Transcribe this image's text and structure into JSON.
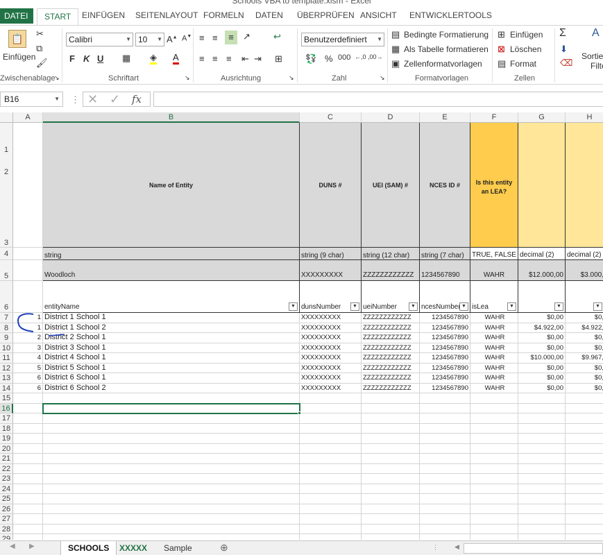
{
  "window": {
    "title": "Schools VBA to template.xlsm - Excel"
  },
  "ribbon_tabs": [
    "DATEI",
    "START",
    "EINFÜGEN",
    "SEITENLAYOUT",
    "FORMELN",
    "DATEN",
    "ÜBERPRÜFEN",
    "ANSICHT",
    "ENTWICKLERTOOLS"
  ],
  "ribbon": {
    "paste_label": "Einfügen",
    "clipboard_label": "Zwischenablage",
    "font_name": "Calibri",
    "font_size": "10",
    "bold": "F",
    "italic": "K",
    "underline": "U",
    "font_label": "Schriftart",
    "align_label": "Ausrichtung",
    "number_format": "Benutzerdefiniert",
    "number_label": "Zahl",
    "cond_format": "Bedingte Formatierung",
    "as_table": "Als Tabelle formatieren",
    "cell_styles": "Zellenformatvorlagen",
    "styles_label": "Formatvorlagen",
    "insert": "Einfügen",
    "delete": "Löschen",
    "format": "Format",
    "cells_label": "Zellen",
    "sort_label": "Sortier",
    "filter_label": "Filte"
  },
  "formula_bar": {
    "name_box": "B16",
    "formula": ""
  },
  "columns": [
    "A",
    "B",
    "C",
    "D",
    "E",
    "F",
    "G",
    "H"
  ],
  "header_row3": {
    "B": "Name of Entity",
    "C": "DUNS #",
    "D": "UEI (SAM) #",
    "E": "NCES ID #",
    "F": "Is this entity an LEA?"
  },
  "row4": {
    "B": "string",
    "C": "string (9 char)",
    "D": "string (12 char)",
    "E": "string (7 char)",
    "F": "TRUE, FALSE",
    "G": "decimal (2)",
    "H": "decimal (2)"
  },
  "row5": {
    "B": "Woodloch",
    "C": "XXXXXXXXX",
    "D": "ZZZZZZZZZZZZ",
    "E": "1234567890",
    "F": "WAHR",
    "G": "$12.000,00",
    "H": "$3.000,"
  },
  "row6": {
    "B": "entityName",
    "C": "dunsNumber",
    "D": "ueiNumber",
    "E": "ncesNumber",
    "F": "isLea"
  },
  "data_rows": [
    {
      "row": "7",
      "A": "1",
      "B": "District 1 School 1",
      "C": "XXXXXXXXX",
      "D": "ZZZZZZZZZZZZ",
      "E": "1234567890",
      "F": "WAHR",
      "G": "$0,00",
      "H": "$0,"
    },
    {
      "row": "8",
      "A": "1",
      "B": "District 1 School 2",
      "C": "XXXXXXXXX",
      "D": "ZZZZZZZZZZZZ",
      "E": "1234567890",
      "F": "WAHR",
      "G": "$4.922,00",
      "H": "$4.922,"
    },
    {
      "row": "9",
      "A": "2",
      "B": "District 2 School 1",
      "C": "XXXXXXXXX",
      "D": "ZZZZZZZZZZZZ",
      "E": "1234567890",
      "F": "WAHR",
      "G": "$0,00",
      "H": "$0,"
    },
    {
      "row": "10",
      "A": "3",
      "B": "District 3 School 1",
      "C": "XXXXXXXXX",
      "D": "ZZZZZZZZZZZZ",
      "E": "1234567890",
      "F": "WAHR",
      "G": "$0,00",
      "H": "$0,"
    },
    {
      "row": "11",
      "A": "4",
      "B": "District 4 School 1",
      "C": "XXXXXXXXX",
      "D": "ZZZZZZZZZZZZ",
      "E": "1234567890",
      "F": "WAHR",
      "G": "$10.000,00",
      "H": "$9.967,"
    },
    {
      "row": "12",
      "A": "5",
      "B": "District 5 School 1",
      "C": "XXXXXXXXX",
      "D": "ZZZZZZZZZZZZ",
      "E": "1234567890",
      "F": "WAHR",
      "G": "$0,00",
      "H": "$0,"
    },
    {
      "row": "13",
      "A": "6",
      "B": "District 6 School 1",
      "C": "XXXXXXXXX",
      "D": "ZZZZZZZZZZZZ",
      "E": "1234567890",
      "F": "WAHR",
      "G": "$0,00",
      "H": "$0,"
    },
    {
      "row": "14",
      "A": "6",
      "B": "District 6 School 2",
      "C": "XXXXXXXXX",
      "D": "ZZZZZZZZZZZZ",
      "E": "1234567890",
      "F": "WAHR",
      "G": "$0,00",
      "H": "$0,"
    }
  ],
  "empty_rows": [
    "14",
    "16",
    "17",
    "18",
    "19",
    "20",
    "21",
    "22",
    "23",
    "24",
    "25",
    "26",
    "27",
    "28",
    "29"
  ],
  "sheet_tabs": [
    "SCHOOLS",
    "XXXXX",
    "Sample"
  ],
  "accent_color": "#217346"
}
